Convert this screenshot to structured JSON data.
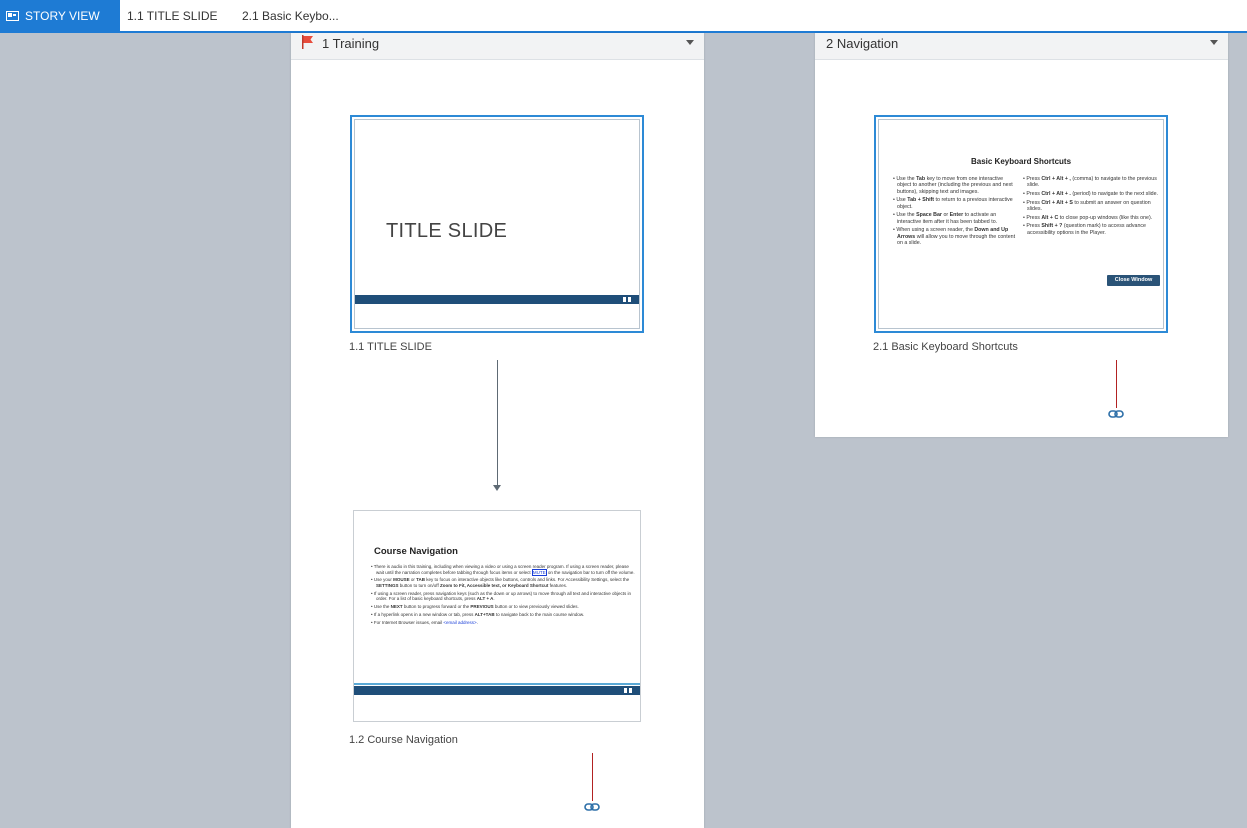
{
  "tabs": [
    {
      "label": "STORY VIEW",
      "active": true,
      "icon": "story-view-icon"
    },
    {
      "label": "1.1 TITLE SLIDE",
      "active": false
    },
    {
      "label": "2.1 Basic Keybo...",
      "active": false
    }
  ],
  "scenes": [
    {
      "title": "1 Training",
      "icon": "flag-icon",
      "slides": [
        {
          "label": "1.1 TITLE SLIDE",
          "selected": true,
          "heading": "TITLE SLIDE"
        },
        {
          "label": "1.2 Course Navigation",
          "selected": false,
          "heading": "Course Navigation",
          "bullets": {
            "b1_part1": "There is audio in this training, including when viewing a video or using a screen reader program. If using a screen reader, please wait until the narration completes before tabbing through focus items or select ",
            "b1_mute": "MUTE",
            "b1_part2": " on the navigation bar to turn off the volume.",
            "b2_part1": "Use your ",
            "b2_mouse": "MOUSE",
            "b2_part2": " or ",
            "b2_tab": "TAB",
            "b2_part3": " key to focus on interactive objects like buttons, controls and links. For Accessibility Settings, select the ",
            "b2_settings": "SETTINGS",
            "b2_part4": " button to turn on/off ",
            "b2_zoom": "Zoom to Fit, Accessible text, or Keyboard Shortcut",
            "b2_part5": " features.",
            "b3_part1": "If using a screen reader, press navigation keys (such as the down or up arrows) to move through all text and interactive objects in order. For a list of basic keyboard shortcuts, press ",
            "b3_alta": "ALT + A",
            "b3_part2": ".",
            "b4_part1": "Use the ",
            "b4_next": "NEXT",
            "b4_part2": " button to progress forward or the ",
            "b4_prev": "PREVIOUS",
            "b4_part3": " button or to view previously viewed slides.",
            "b5_part1": "If a hyperlink opens in a new window or tab, press ",
            "b5_alttab": "ALT+TAB",
            "b5_part2": " to navigate back to the main course window.",
            "b6_part1": "For Internet Browser issues, email ",
            "b6_email": "<email address>",
            "b6_part2": "."
          }
        }
      ]
    },
    {
      "title": "2 Navigation",
      "slides": [
        {
          "label": "2.1 Basic Keyboard Shortcuts",
          "selected": true,
          "heading": "Basic Keyboard Shortcuts",
          "left": {
            "l1a": "Use the ",
            "l1b": "Tab",
            "l1c": " key to move from one interactive object  to another (including the previous and next buttons), skipping text and images.",
            "l2a": "Use ",
            "l2b": "Tab + Shift",
            "l2c": " to return to a previous interactive object.",
            "l3a": "Use the ",
            "l3b": "Space Bar",
            "l3c": " or ",
            "l3d": "Enter",
            "l3e": " to activate an interactive item after it has been tabbed to.",
            "l4a": "When using a screen reader, the ",
            "l4b": "Down and Up Arrows",
            "l4c": " will allow you to move through the content on a slide."
          },
          "right": {
            "r1a": "Press ",
            "r1b": "Ctrl + Alt + ,",
            "r1c": " (comma) to navigate to the previous slide.",
            "r2a": "Press ",
            "r2b": "Ctrl + Alt + .",
            "r2c": " (period) to navigate to the next slide.",
            "r3a": "Press ",
            "r3b": "Ctrl + Alt + S",
            "r3c": " to submit an answer on question slides.",
            "r4a": "Press ",
            "r4b": "Alt + C",
            "r4c": " to close pop-up windows (like this one).",
            "r5a": "Press ",
            "r5b": "Shift + ?",
            "r5c": " (question mark) to access advance accessibility options in the Player."
          },
          "button": "Close Window"
        }
      ]
    }
  ],
  "colors": {
    "accent": "#1e7bd4",
    "canvas": "#bcc3cc",
    "footer_bar": "#1f4e79",
    "link_connector": "#b22222",
    "flow_connector": "#5e6a74"
  }
}
